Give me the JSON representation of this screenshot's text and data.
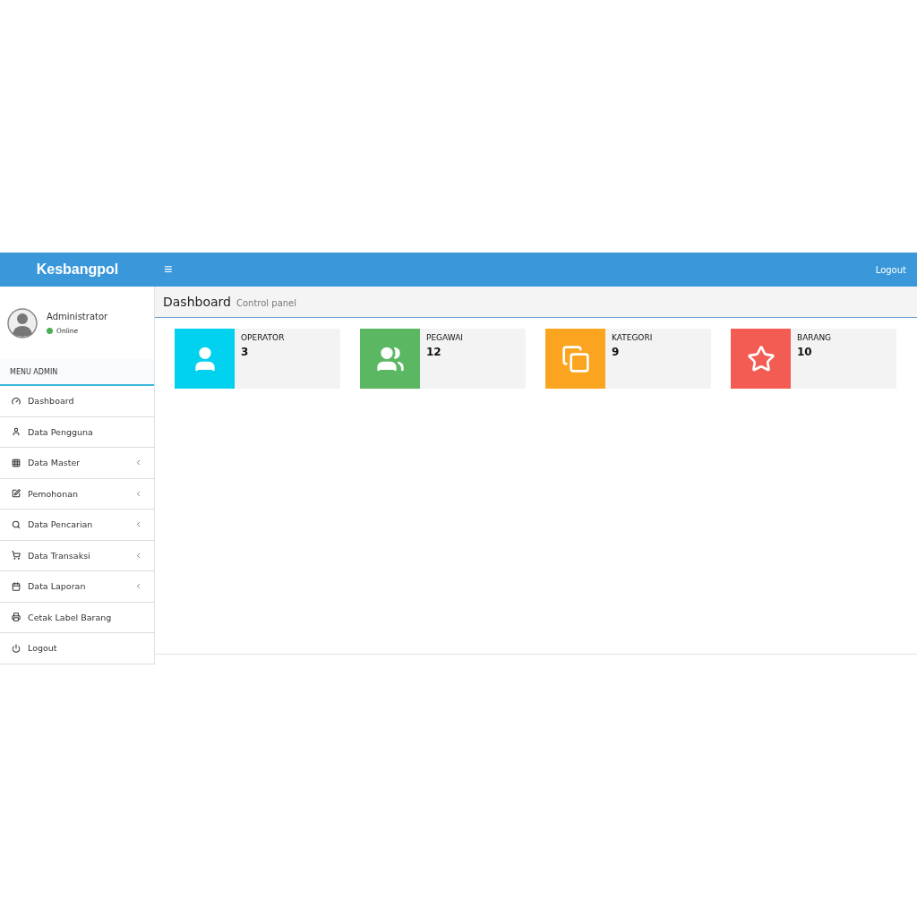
{
  "header": {
    "brand": "Kesbangpol",
    "menu_toggle": "≡",
    "logout": "Logout"
  },
  "user": {
    "name": "Administrator",
    "status": "Online"
  },
  "sidebar": {
    "heading": "MENU ADMIN",
    "items": [
      {
        "label": "Dashboard",
        "submenu": false
      },
      {
        "label": "Data Pengguna",
        "submenu": false
      },
      {
        "label": "Data Master",
        "submenu": true
      },
      {
        "label": "Pemohonan",
        "submenu": true
      },
      {
        "label": "Data Pencarian",
        "submenu": true
      },
      {
        "label": "Data Transaksi",
        "submenu": true
      },
      {
        "label": "Data Laporan",
        "submenu": true
      },
      {
        "label": "Cetak Label Barang",
        "submenu": false
      },
      {
        "label": "Logout",
        "submenu": false
      }
    ]
  },
  "page": {
    "title": "Dashboard",
    "subtitle": "Control panel"
  },
  "stats": [
    {
      "label": "OPERATOR",
      "value": "3",
      "color": "#00d1ee"
    },
    {
      "label": "PEGAWAI",
      "value": "12",
      "color": "#5cb762"
    },
    {
      "label": "KATEGORI",
      "value": "9",
      "color": "#fba41f"
    },
    {
      "label": "BARANG",
      "value": "10",
      "color": "#f35c52"
    }
  ]
}
